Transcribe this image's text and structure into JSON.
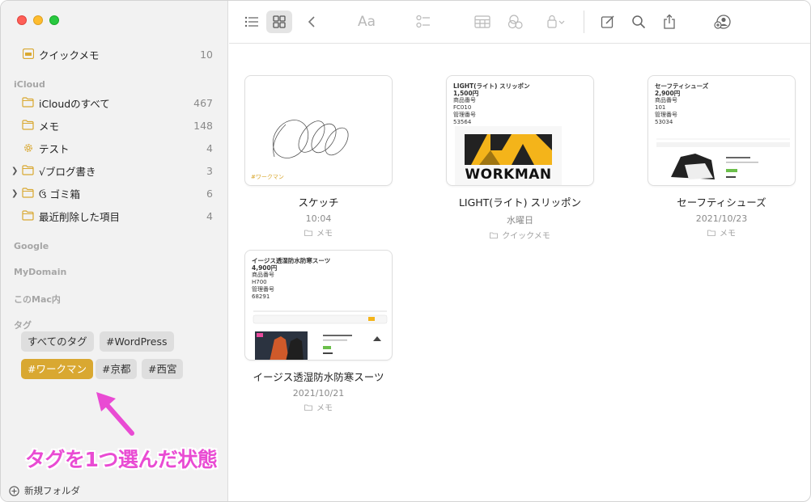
{
  "sidebar": {
    "quick_note": {
      "label": "クイックメモ",
      "count": "10"
    },
    "icloud_header": "iCloud",
    "folders": [
      {
        "label": "iCloudのすべて",
        "count": "467"
      },
      {
        "label": "メモ",
        "count": "148"
      },
      {
        "label": "テスト",
        "count": "4"
      },
      {
        "label": "√ブログ書き",
        "count": "3"
      },
      {
        "label": "ゴミ箱",
        "count": "6"
      },
      {
        "label": "最近削除した項目",
        "count": "4"
      }
    ],
    "trash_glyph": "ઉ",
    "google_header": "Google",
    "mydomain_header": "MyDomain",
    "mac_header": "このMac内",
    "tags_header": "タグ",
    "tags": [
      "すべてのタグ",
      "#WordPress",
      "#ワークマン",
      "#京都",
      "#西宮"
    ],
    "selected_tag": "#ワークマン",
    "new_folder": "新規フォルダ"
  },
  "annotation": "タグを1つ選んだ状態",
  "toolbar": {
    "font_label": "Aa"
  },
  "notes": [
    {
      "title": "スケッチ",
      "date": "10:04",
      "folder": "メモ",
      "preview_tag": "#ワークマン"
    },
    {
      "title": "LIGHT(ライト) スリッポン",
      "date": "水曜日",
      "folder": "クイックメモ",
      "preview": {
        "name": "LIGHT(ライト) スリッポン",
        "price": "1,500円",
        "l1": "商品番号",
        "l2": "FC010",
        "l3": "管理番号",
        "l4": "53564",
        "logo": "WORKMAN"
      }
    },
    {
      "title": "セーフティシューズ",
      "date": "2021/10/23",
      "folder": "メモ",
      "preview": {
        "name": "セーフティシューズ",
        "price": "2,900円",
        "l1": "商品番号",
        "l2": "101",
        "l3": "管理番号",
        "l4": "53034"
      }
    },
    {
      "title": "イージス透湿防水防寒スーツ",
      "date": "2021/10/21",
      "folder": "メモ",
      "preview": {
        "name": "イージス透湿防水防寒スーツ",
        "price": "4,900円",
        "l1": "商品番号",
        "l2": "H700",
        "l3": "管理番号",
        "l4": "68291"
      }
    }
  ],
  "colors": {
    "accent": "#d9a831",
    "annotation": "#e94bd3",
    "folder_icon": "#d9a831"
  }
}
